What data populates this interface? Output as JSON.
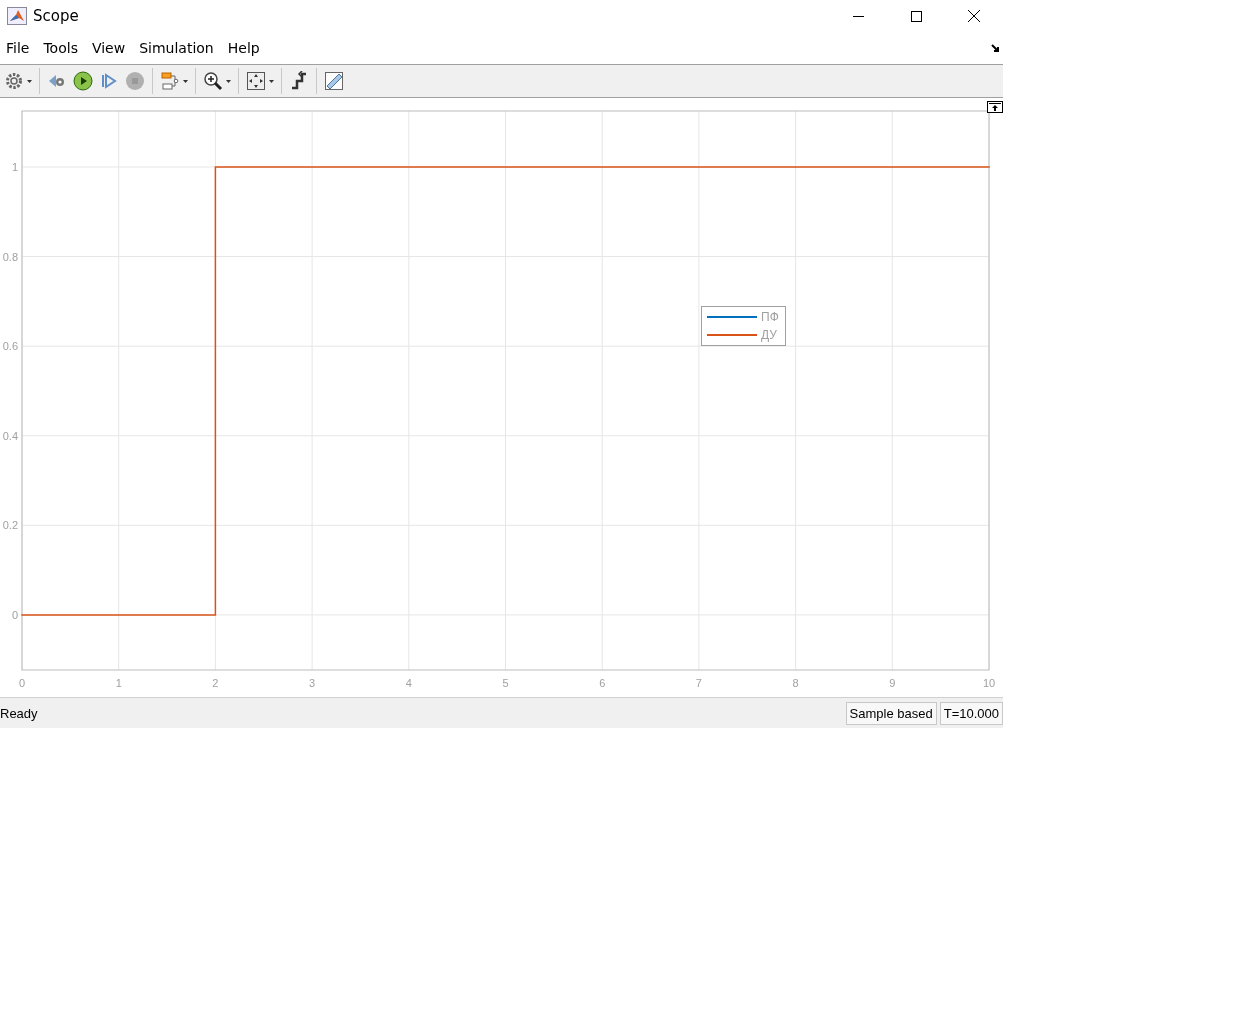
{
  "window": {
    "title": "Scope"
  },
  "menu": [
    {
      "label": "File"
    },
    {
      "label": "Tools"
    },
    {
      "label": "View"
    },
    {
      "label": "Simulation"
    },
    {
      "label": "Help"
    }
  ],
  "plot": {
    "chart_data": {
      "type": "line",
      "grid": true,
      "x": [
        0,
        2,
        2,
        10
      ],
      "xlim": [
        0,
        10
      ],
      "ylim": [
        -0.123,
        1.125
      ],
      "xticks": [
        0,
        1,
        2,
        3,
        4,
        5,
        6,
        7,
        8,
        9,
        10
      ],
      "yticks": [
        0,
        0.2,
        0.4,
        0.6,
        0.8,
        1
      ],
      "series": [
        {
          "name": "ПФ",
          "color": "#0072bd",
          "values": [
            null,
            null,
            null,
            null
          ]
        },
        {
          "name": "ДУ",
          "color": "#d95319",
          "values": [
            0,
            0,
            1,
            1
          ]
        }
      ]
    }
  },
  "status_bar": {
    "message": "Ready",
    "mode": "Sample based",
    "time": "T=10.000"
  }
}
